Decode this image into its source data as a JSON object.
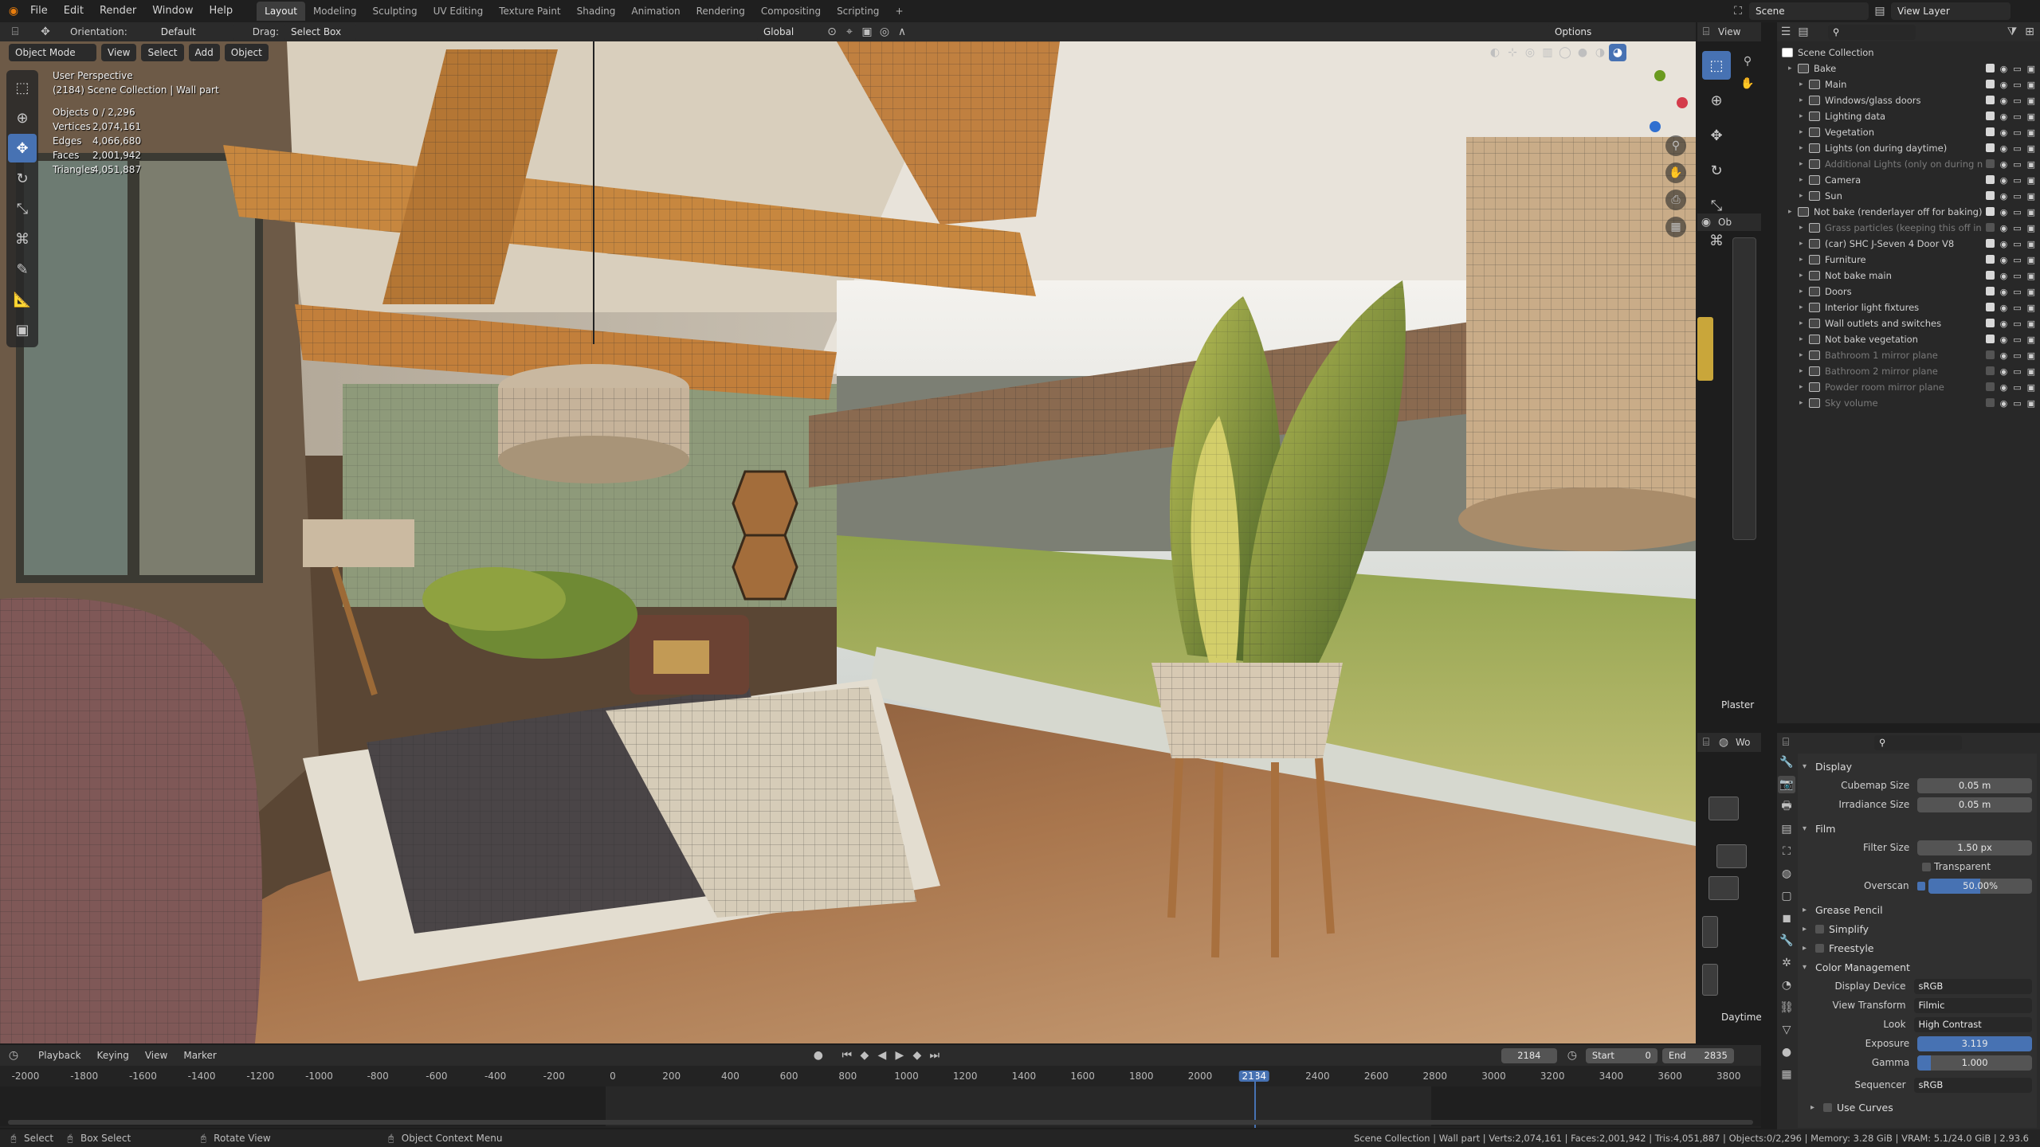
{
  "topbar": {
    "menus": [
      "File",
      "Edit",
      "Render",
      "Window",
      "Help"
    ],
    "workspaces": [
      "Layout",
      "Modeling",
      "Sculpting",
      "UV Editing",
      "Texture Paint",
      "Shading",
      "Animation",
      "Rendering",
      "Compositing",
      "Scripting"
    ],
    "add_tab": "+",
    "scene_label": "Scene",
    "view_layer_label": "View Layer"
  },
  "header": {
    "orientation_label": "Orientation:",
    "orientation_value": "Default",
    "drag_label": "Drag:",
    "drag_value": "Select Box",
    "transform_space": "Global",
    "options": "Options"
  },
  "viewport_header": {
    "mode": "Object Mode",
    "menus": [
      "View",
      "Select",
      "Add",
      "Object"
    ]
  },
  "viewport": {
    "perspective": "User Perspective",
    "collection": "(2184) Scene Collection | Wall part",
    "stats": [
      {
        "label": "Objects",
        "value": "0 / 2,296"
      },
      {
        "label": "Vertices",
        "value": "2,074,161"
      },
      {
        "label": "Edges",
        "value": "4,066,680"
      },
      {
        "label": "Faces",
        "value": "2,001,942"
      },
      {
        "label": "Triangles",
        "value": "4,051,887"
      }
    ]
  },
  "node_editor": {
    "view_menu": "View",
    "node_label_1": "Plaster",
    "node_label_2": "Daytime",
    "obj_label": "Ob",
    "world_label": "Wo"
  },
  "outliner": {
    "root": "Scene Collection",
    "items": [
      {
        "label": "Bake",
        "level": 0,
        "dim": false,
        "check": true
      },
      {
        "label": "Main",
        "level": 1,
        "dim": false,
        "check": true
      },
      {
        "label": "Windows/glass doors",
        "level": 1,
        "dim": false,
        "check": true
      },
      {
        "label": "Lighting data",
        "level": 1,
        "dim": false,
        "check": true
      },
      {
        "label": "Vegetation",
        "level": 1,
        "dim": false,
        "check": true
      },
      {
        "label": "Lights (on during daytime)",
        "level": 1,
        "dim": false,
        "check": true
      },
      {
        "label": "Additional Lights (only on during n",
        "level": 1,
        "dim": true,
        "check": false
      },
      {
        "label": "Camera",
        "level": 1,
        "dim": false,
        "check": true
      },
      {
        "label": "Sun",
        "level": 1,
        "dim": false,
        "check": true
      },
      {
        "label": "Not bake (renderlayer off for baking)",
        "level": 0,
        "dim": false,
        "check": true
      },
      {
        "label": "Grass particles (keeping this off in",
        "level": 1,
        "dim": true,
        "check": false
      },
      {
        "label": "(car) SHC J-Seven 4 Door V8",
        "level": 1,
        "dim": false,
        "check": true
      },
      {
        "label": "Furniture",
        "level": 1,
        "dim": false,
        "check": true
      },
      {
        "label": "Not bake main",
        "level": 1,
        "dim": false,
        "check": true
      },
      {
        "label": "Doors",
        "level": 1,
        "dim": false,
        "check": true
      },
      {
        "label": "Interior light fixtures",
        "level": 1,
        "dim": false,
        "check": true
      },
      {
        "label": "Wall outlets and switches",
        "level": 1,
        "dim": false,
        "check": true
      },
      {
        "label": "Not bake vegetation",
        "level": 1,
        "dim": false,
        "check": true
      },
      {
        "label": "Bathroom 1 mirror plane",
        "level": 1,
        "dim": true,
        "check": false
      },
      {
        "label": "Bathroom 2 mirror plane",
        "level": 1,
        "dim": true,
        "check": false
      },
      {
        "label": "Powder room mirror plane",
        "level": 1,
        "dim": true,
        "check": false
      },
      {
        "label": "Sky volume",
        "level": 1,
        "dim": true,
        "check": false
      }
    ]
  },
  "properties": {
    "display_header": "Display",
    "cubemap_label": "Cubemap Size",
    "cubemap_value": "0.05 m",
    "irradiance_label": "Irradiance Size",
    "irradiance_value": "0.05 m",
    "film_header": "Film",
    "filter_label": "Filter Size",
    "filter_value": "1.50 px",
    "transparent_label": "Transparent",
    "overscan_label": "Overscan",
    "overscan_value": "50.00%",
    "overscan_fraction": 0.5,
    "grease_pencil": "Grease Pencil",
    "simplify": "Simplify",
    "freestyle": "Freestyle",
    "color_mgmt": "Color Management",
    "display_device_label": "Display Device",
    "display_device_value": "sRGB",
    "view_transform_label": "View Transform",
    "view_transform_value": "Filmic",
    "look_label": "Look",
    "look_value": "High Contrast",
    "exposure_label": "Exposure",
    "exposure_value": "3.119",
    "gamma_label": "Gamma",
    "gamma_value": "1.000",
    "sequencer_label": "Sequencer",
    "sequencer_value": "sRGB",
    "use_curves": "Use Curves"
  },
  "timeline": {
    "menus": [
      "Playback",
      "Keying",
      "View",
      "Marker"
    ],
    "current_frame": "2184",
    "start_label": "Start",
    "start_value": "0",
    "end_label": "End",
    "end_value": "2835",
    "ticks": [
      "-2000",
      "-1800",
      "-1600",
      "-1400",
      "-1200",
      "-1000",
      "-800",
      "-600",
      "-400",
      "-200",
      "0",
      "200",
      "400",
      "600",
      "800",
      "1000",
      "1200",
      "1400",
      "1600",
      "1800",
      "2000",
      "2184",
      "2400",
      "2600",
      "2800",
      "3000",
      "3200",
      "3400",
      "3600",
      "3800"
    ]
  },
  "statusbar": {
    "select": "Select",
    "box_select": "Box Select",
    "rotate_view": "Rotate View",
    "context_menu": "Object Context Menu",
    "info": "Scene Collection | Wall part | Verts:2,074,161 | Faces:2,001,942 | Tris:4,051,887 | Objects:0/2,296 | Memory: 3.28 GiB | VRAM: 5.1/24.0 GiB | 2.93.6"
  },
  "colors": {
    "accent": "#4772b3",
    "panel": "#303030",
    "header": "#2b2b2b",
    "timeline_playhead": "#4772b3"
  }
}
